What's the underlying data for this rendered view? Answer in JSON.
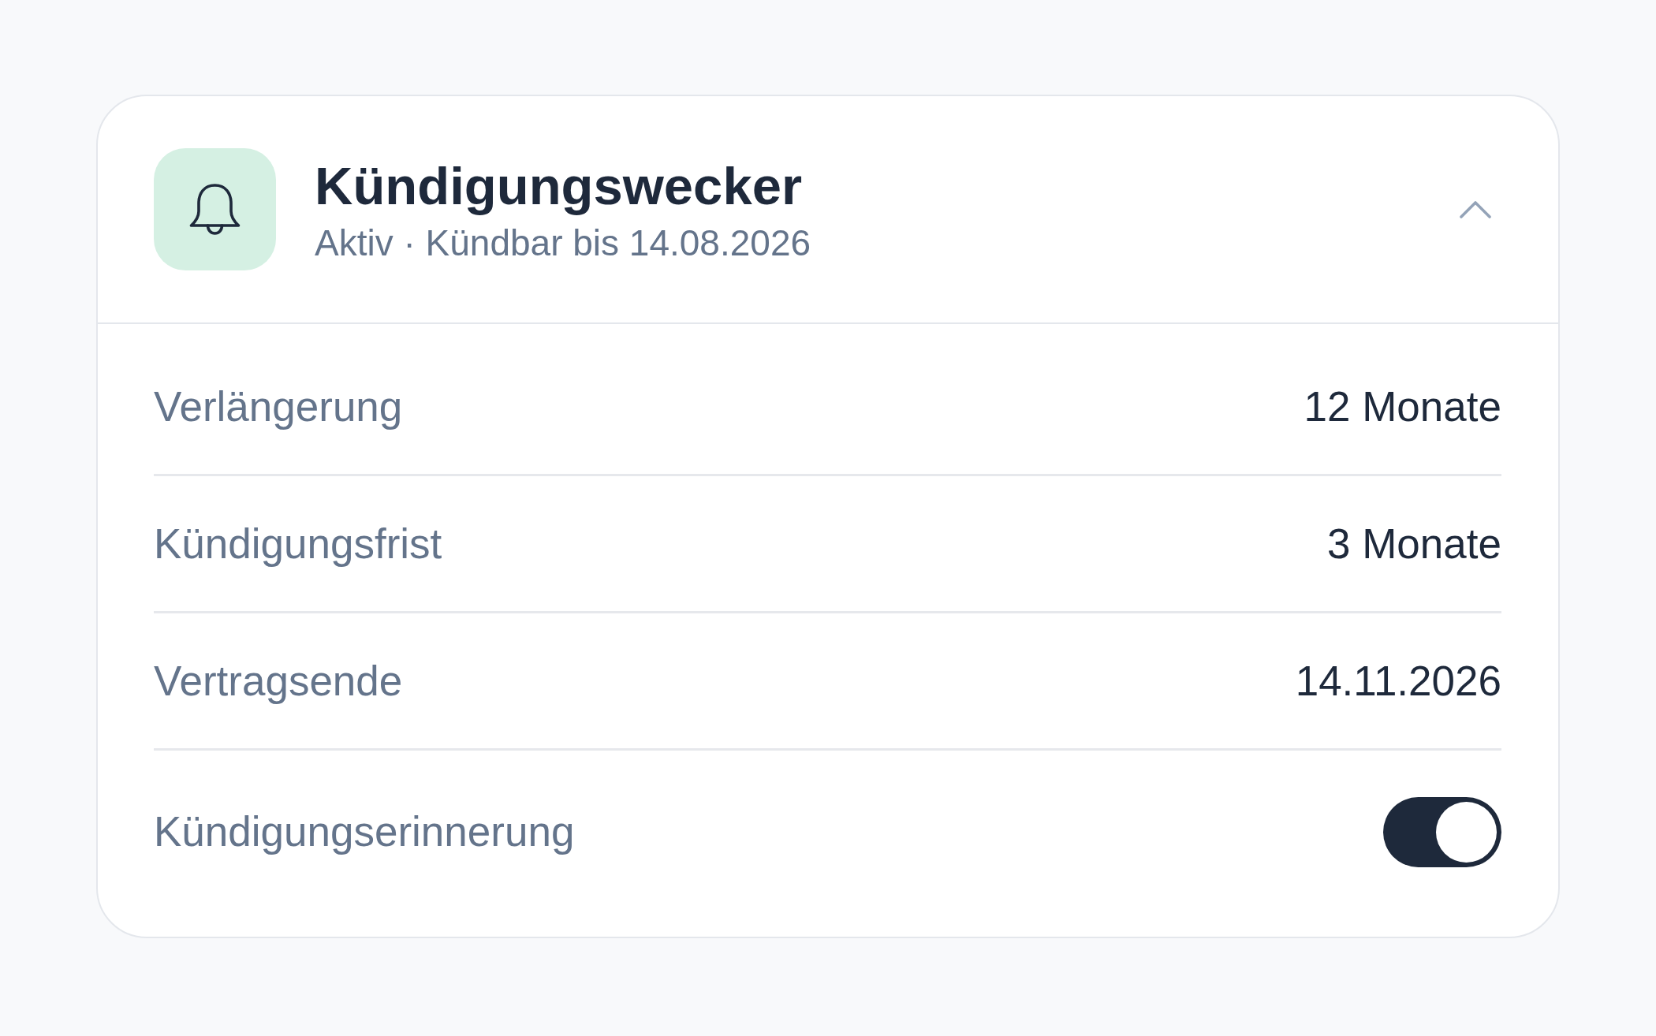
{
  "card": {
    "title": "Kündigungswecker",
    "subtitle": "Aktiv · Kündbar bis 14.08.2026",
    "expanded": true
  },
  "rows": [
    {
      "kind": "value",
      "label": "Verlängerung",
      "value": "12 Monate"
    },
    {
      "kind": "value",
      "label": "Kündigungsfrist",
      "value": "3 Monate"
    },
    {
      "kind": "value",
      "label": "Vertragsende",
      "value": "14.11.2026"
    },
    {
      "kind": "toggle",
      "label": "Kündigungserinnerung",
      "on": true
    }
  ]
}
